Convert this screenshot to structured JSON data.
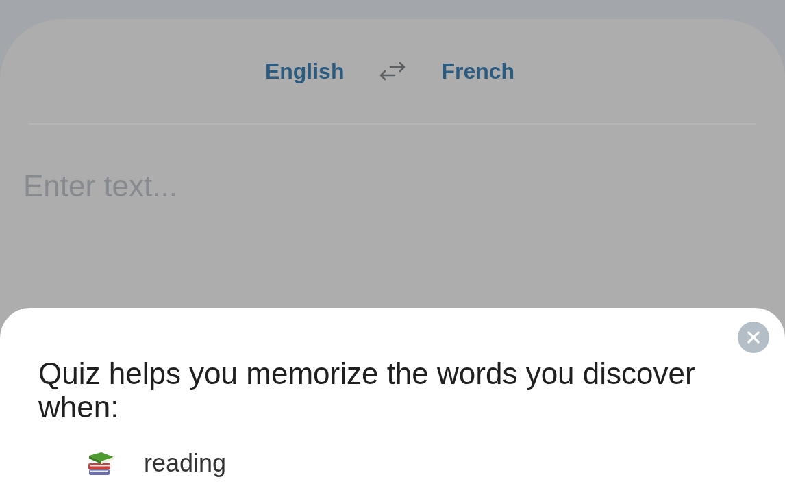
{
  "language_bar": {
    "source_language": "English",
    "target_language": "French"
  },
  "input": {
    "placeholder": "Enter text..."
  },
  "quiz_sheet": {
    "title": "Quiz helps you memorize the words you discover when:",
    "items": [
      {
        "label": "reading"
      }
    ]
  }
}
